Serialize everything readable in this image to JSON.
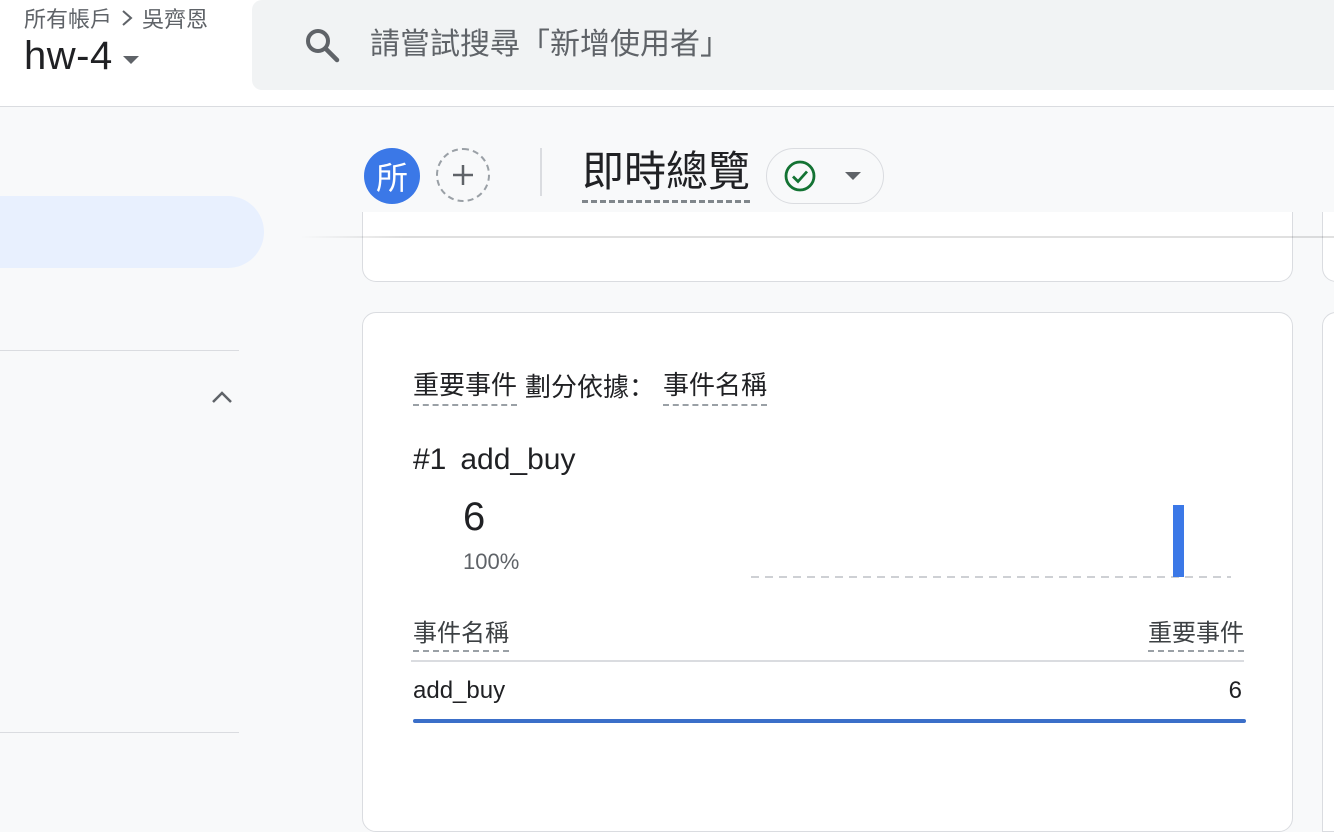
{
  "breadcrumb": {
    "account": "所有帳戶",
    "separator": ">",
    "user": "吳齊恩"
  },
  "property": {
    "name": "hw-4"
  },
  "search": {
    "placeholder": "請嘗試搜尋「新增使用者」"
  },
  "header": {
    "avatar_letter": "所",
    "page_title": "即時總覽"
  },
  "card": {
    "title_metric": "重要事件",
    "title_mid": "劃分依據：",
    "title_dimension": "事件名稱",
    "rank": "#1",
    "top_event": "add_buy",
    "top_value": "6",
    "top_percent": "100%",
    "table": {
      "col_left": "事件名稱",
      "col_right": "重要事件",
      "rows": [
        {
          "name": "add_buy",
          "value": "6",
          "share": 1.0
        }
      ]
    }
  },
  "chart_data": {
    "type": "bar",
    "categories": [
      "",
      "",
      "",
      "",
      "",
      "",
      "",
      "",
      "",
      "",
      "",
      "",
      "",
      "",
      "",
      "",
      "",
      "",
      "",
      "",
      "",
      "",
      "",
      "",
      "",
      "",
      "",
      "",
      "",
      ""
    ],
    "values": [
      0,
      0,
      0,
      0,
      0,
      0,
      0,
      0,
      0,
      0,
      0,
      0,
      0,
      0,
      0,
      0,
      0,
      0,
      0,
      0,
      0,
      0,
      0,
      0,
      0,
      0,
      0,
      0,
      6,
      0,
      0,
      0
    ],
    "color": "#3b78e7",
    "baseline_style": "dashed"
  },
  "colors": {
    "accent": "#3b78e7",
    "active_nav": "#e8f0fe",
    "status_green": "#137333"
  }
}
